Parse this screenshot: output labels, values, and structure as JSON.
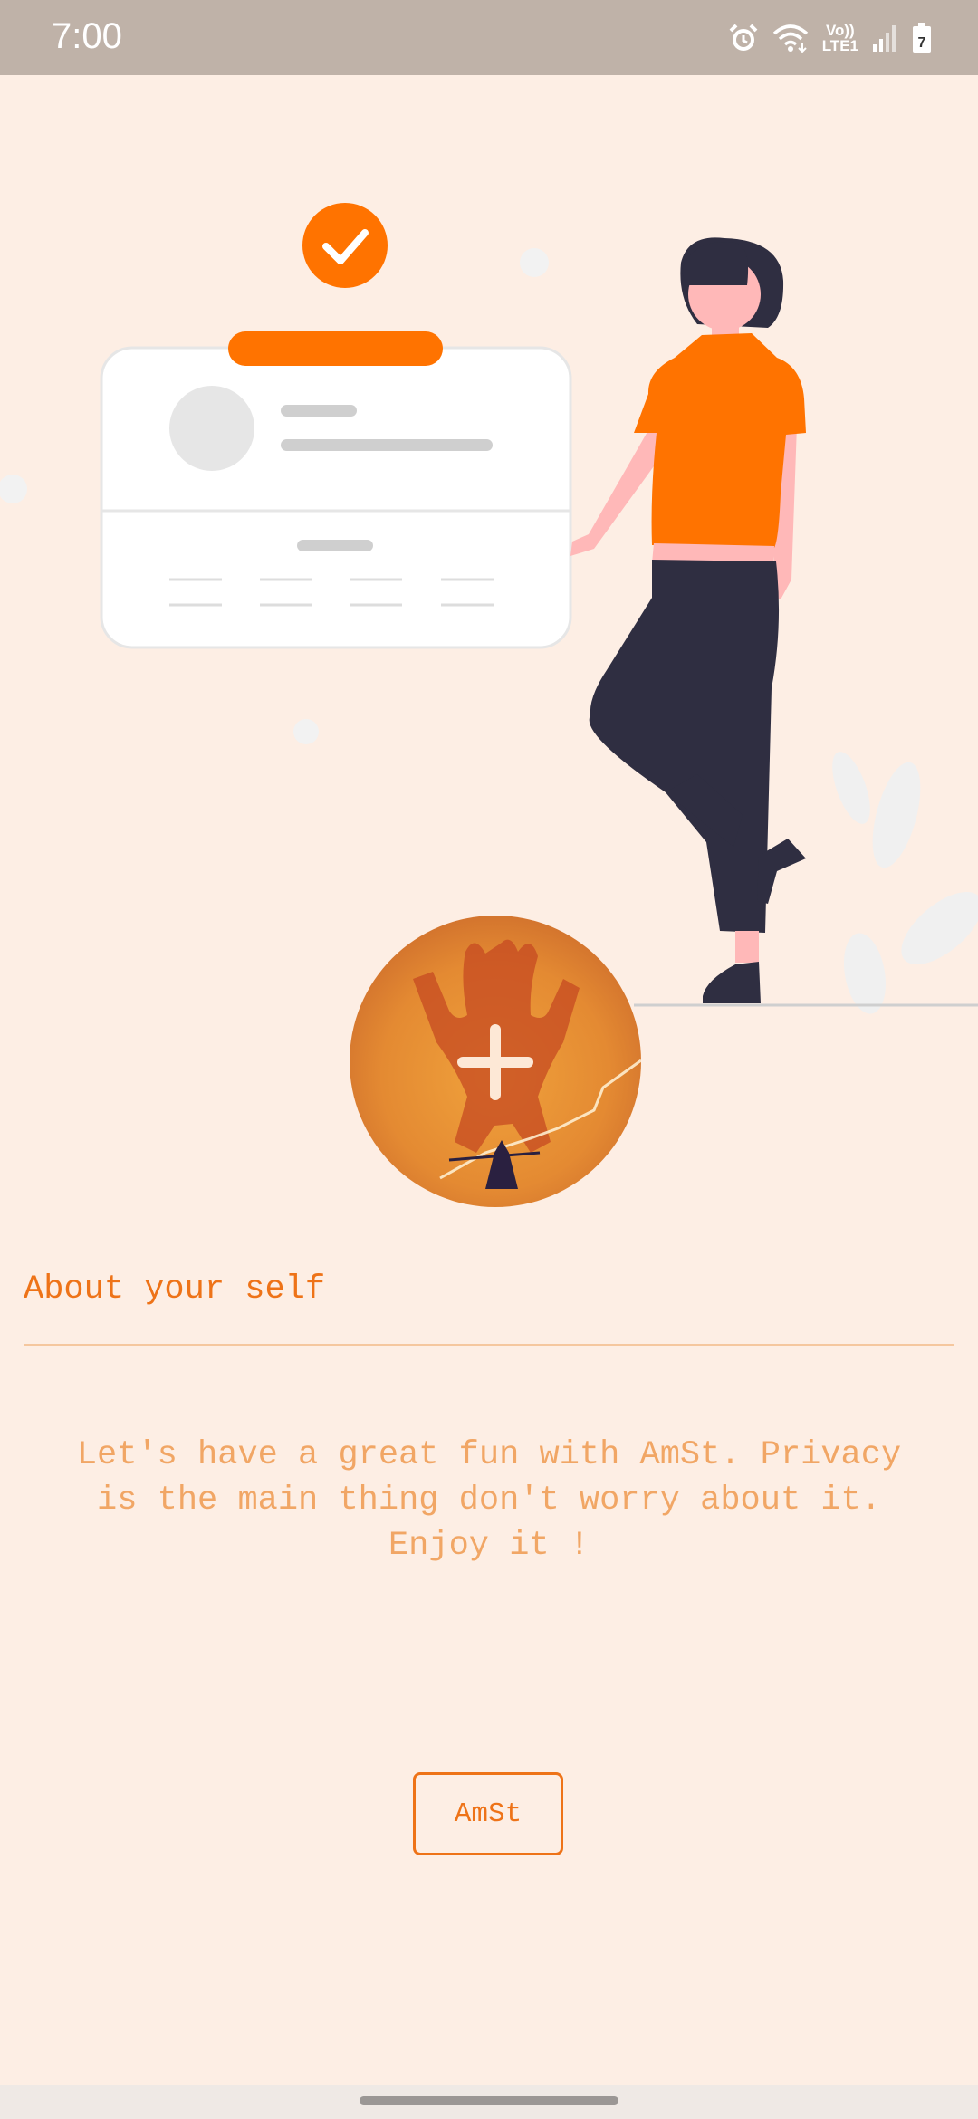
{
  "status_bar": {
    "time": "7:00",
    "network_badge_line1": "Vo))",
    "network_badge_line2": "LTE1",
    "icons": [
      "alarm-icon",
      "wifi-icon",
      "volte-badge",
      "signal-icon",
      "battery-icon"
    ],
    "battery_level": "7"
  },
  "illustration": {
    "icons": [
      "checkmark-icon",
      "profile-card",
      "woman-figure",
      "plant-decoration"
    ]
  },
  "avatar_picker": {
    "icon": "plus-icon"
  },
  "about": {
    "label": "About your self"
  },
  "intro": {
    "text": "Let's have a great fun with AmSt. Privacy\nis the main thing don't worry about it.\nEnjoy it !"
  },
  "button": {
    "label": "AmSt"
  },
  "colors": {
    "background": "#fdeee4",
    "accent": "#ff7300",
    "label_text": "#ee7318",
    "intro_text": "#f1a665",
    "status_bar": "#bfb2a8"
  }
}
